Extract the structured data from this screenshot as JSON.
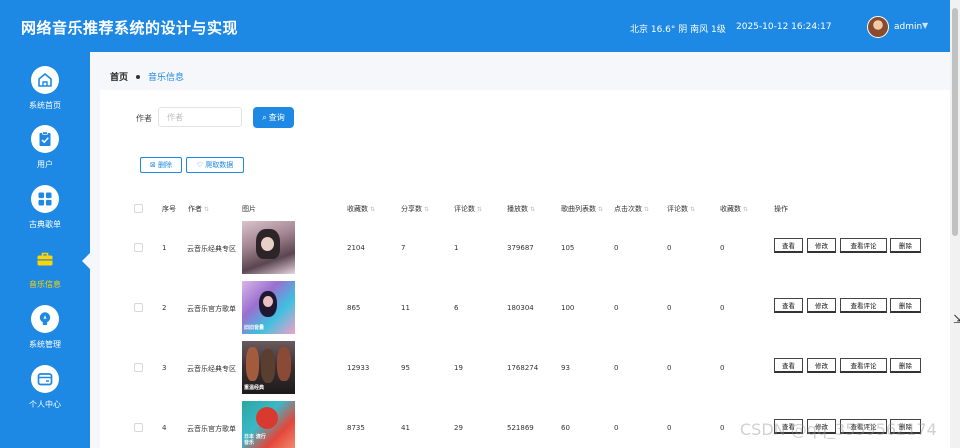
{
  "header": {
    "title": "网络音乐推荐系统的设计与实现",
    "weather": "北京 16.6° 阴 南风 1级",
    "datetime": "2025-10-12 16:24:17",
    "user": "admin",
    "background_color": "#1e88e5"
  },
  "sidebar": {
    "items": [
      {
        "label": "系统首页",
        "icon": "home-icon"
      },
      {
        "label": "用户",
        "icon": "clipboard-icon"
      },
      {
        "label": "古典歌单",
        "icon": "grid-icon"
      },
      {
        "label": "音乐信息",
        "icon": "briefcase-icon",
        "active": true
      },
      {
        "label": "系统管理",
        "icon": "lightbulb-icon"
      },
      {
        "label": "个人中心",
        "icon": "wallet-icon"
      }
    ],
    "active_label_color": "#ffd500"
  },
  "breadcrumb": {
    "home": "首页",
    "current": "音乐信息"
  },
  "search": {
    "label": "作者",
    "placeholder": "作者",
    "button": "查询"
  },
  "toolbar": {
    "delete": "删除",
    "crawl": "爬取数据"
  },
  "table": {
    "headers": [
      "序号",
      "作者",
      "图片",
      "收藏数",
      "分享数",
      "评论数",
      "播放数",
      "歌曲列表数",
      "点击次数",
      "评论数",
      "收藏数",
      "操作"
    ],
    "rows": [
      {
        "index": "1",
        "author": "云音乐经典专区",
        "image_label": "",
        "favorites": "2104",
        "shares": "7",
        "comments": "1",
        "plays": "379687",
        "songs": "105",
        "clicks": "0",
        "reviews": "0",
        "collects": "0"
      },
      {
        "index": "2",
        "author": "云音乐官方歌单",
        "image_label": "旧旧音量",
        "favorites": "865",
        "shares": "11",
        "comments": "6",
        "plays": "180304",
        "songs": "100",
        "clicks": "0",
        "reviews": "0",
        "collects": "0"
      },
      {
        "index": "3",
        "author": "云音乐经典专区",
        "image_label": "重温经典",
        "favorites": "12933",
        "shares": "95",
        "comments": "19",
        "plays": "1768274",
        "songs": "93",
        "clicks": "0",
        "reviews": "0",
        "collects": "0"
      },
      {
        "index": "4",
        "author": "云音乐官方歌单",
        "image_label": "日本 流行音乐",
        "favorites": "8735",
        "shares": "41",
        "comments": "29",
        "plays": "521869",
        "songs": "60",
        "clicks": "0",
        "reviews": "0",
        "collects": "0"
      }
    ],
    "actions": [
      "查看",
      "修改",
      "查看评论",
      "删除"
    ]
  },
  "watermark": "CSDN @qq_3559562174"
}
